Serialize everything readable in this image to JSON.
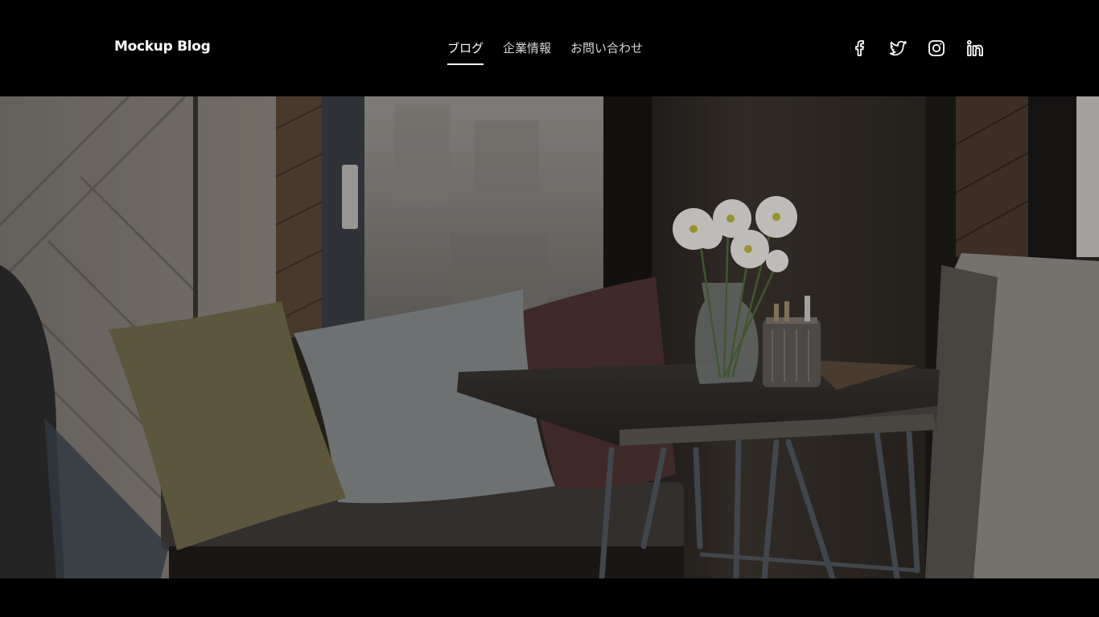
{
  "site": {
    "title": "Mockup Blog"
  },
  "nav": {
    "items": [
      {
        "label": "ブログ",
        "active": true
      },
      {
        "label": "企業情報",
        "active": false
      },
      {
        "label": "お問い合わせ",
        "active": false
      }
    ]
  },
  "social": {
    "icons": [
      "facebook-icon",
      "twitter-icon",
      "instagram-icon",
      "linkedin-icon"
    ]
  },
  "hero": {
    "image_subject": "cafe corner with bench, cushions, wooden table and vase of white daisies"
  },
  "colors": {
    "header_bg": "#000000",
    "nav_text": "#d8d8d8",
    "nav_active": "#ffffff"
  }
}
